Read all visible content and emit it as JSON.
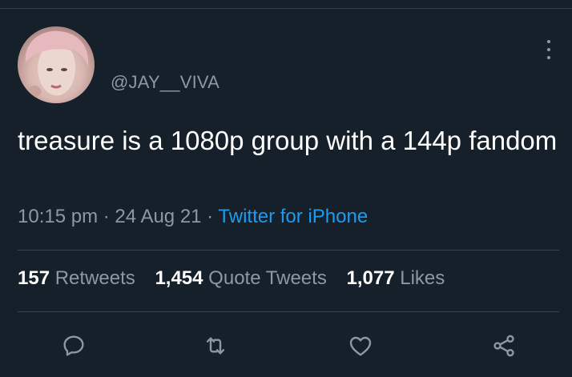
{
  "tweet": {
    "handle": "@JAY__VIVA",
    "text": "treasure is a 1080p group with a 144p fandom",
    "time": "10:15 pm",
    "date": "24 Aug 21",
    "separator": " · ",
    "source": "Twitter for iPhone"
  },
  "stats": {
    "retweets": {
      "count": "157",
      "label": "Retweets"
    },
    "quotes": {
      "count": "1,454",
      "label": "Quote Tweets"
    },
    "likes": {
      "count": "1,077",
      "label": "Likes"
    }
  },
  "actions": [
    "reply-icon",
    "retweet-icon",
    "like-icon",
    "share-icon"
  ],
  "colors": {
    "background": "#15202b",
    "text": "#ffffff",
    "muted": "#8b98a5",
    "link": "#1d9bf0",
    "divider": "#38444d"
  }
}
